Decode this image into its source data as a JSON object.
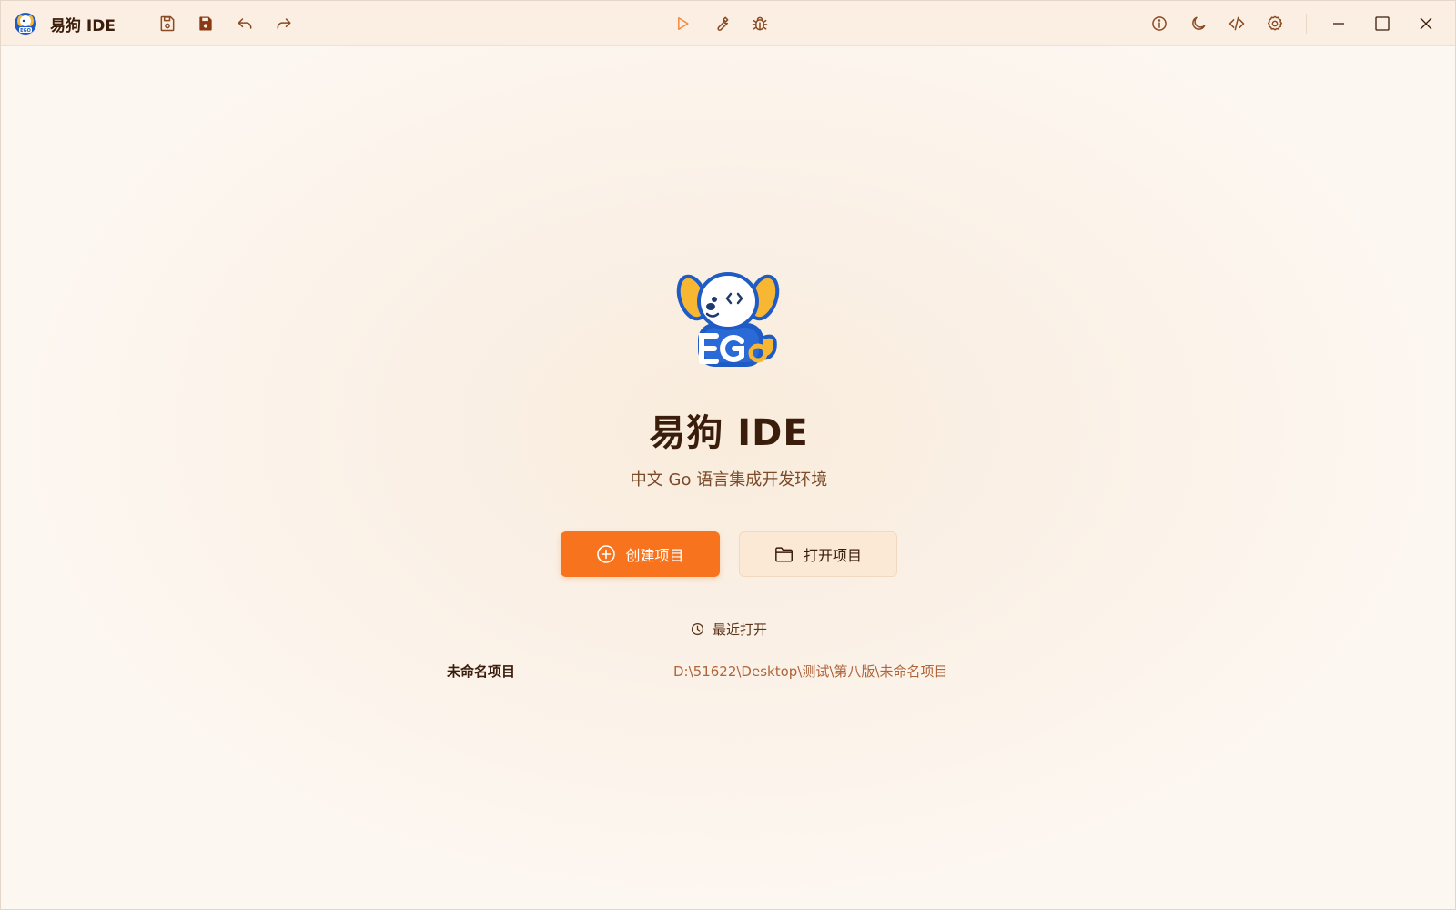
{
  "window": {
    "title": "易狗 IDE",
    "toolbar": {
      "save_icon": "save-outline-icon",
      "save_all_icon": "save-filled-icon",
      "undo_icon": "undo-icon",
      "redo_icon": "redo-icon",
      "run_icon": "play-icon",
      "build_icon": "wrench-icon",
      "debug_icon": "bug-icon",
      "about_icon": "info-icon",
      "theme_icon": "moon-icon",
      "code_icon": "code-icon",
      "settings_icon": "gear-icon"
    },
    "controls": [
      "minimize",
      "maximize",
      "close"
    ]
  },
  "welcome": {
    "title": "易狗 IDE",
    "subtitle": "中文 Go 语言集成开发环境",
    "create_label": "创建项目",
    "open_label": "打开项目",
    "recent_heading": "最近打开",
    "recent_projects": [
      {
        "name": "未命名项目",
        "path": "D:\\51622\\Desktop\\测试\\第八版\\未命名项目"
      }
    ]
  },
  "colors": {
    "accent": "#f8731d",
    "run_icon": "#f38a3c",
    "text_dark": "#3a1d0a",
    "path_text": "#b0653a",
    "titlebar_bg": "#fbeee2",
    "mascot_blue": "#1f5bc4",
    "mascot_yellow": "#f7b733"
  }
}
